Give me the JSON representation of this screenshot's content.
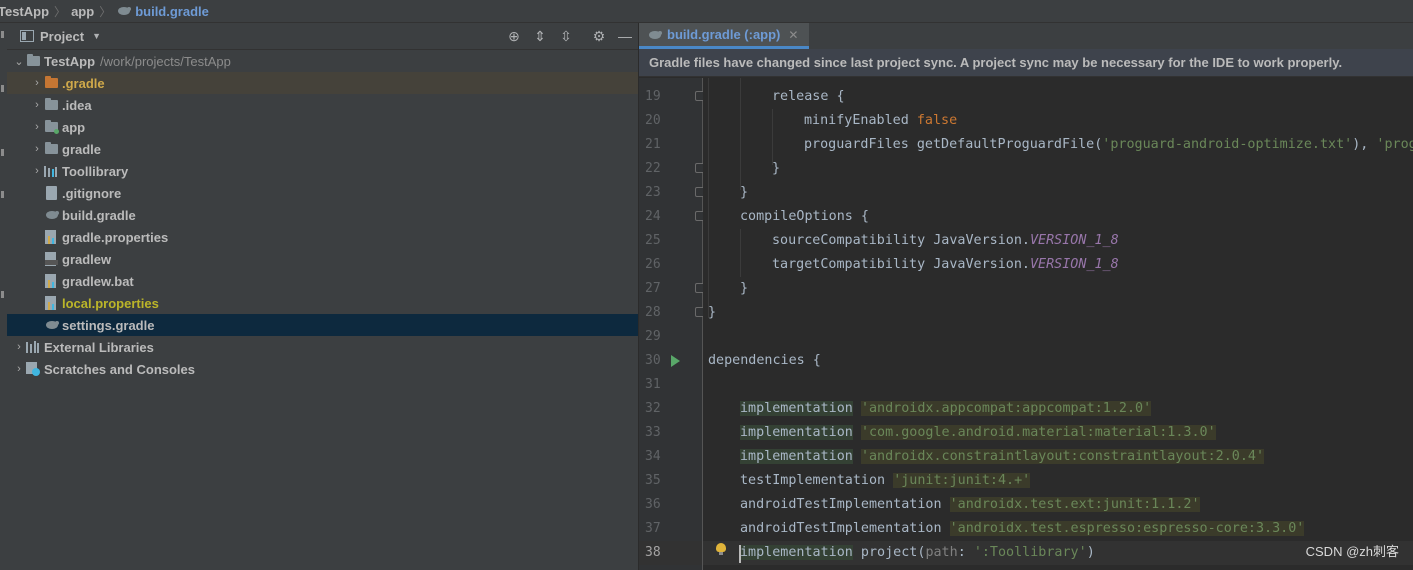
{
  "breadcrumb": [
    "TestApp",
    "app",
    "build.gradle"
  ],
  "project_panel": {
    "title": "Project",
    "root": {
      "label": "TestApp",
      "path": "/work/projects/TestApp"
    },
    "items": [
      {
        "label": ".gradle",
        "kind": "folder-orange",
        "expandable": true
      },
      {
        "label": ".idea",
        "kind": "folder",
        "expandable": true
      },
      {
        "label": "app",
        "kind": "module",
        "expandable": true
      },
      {
        "label": "gradle",
        "kind": "folder",
        "expandable": true
      },
      {
        "label": "Toollibrary",
        "kind": "library-module",
        "expandable": true
      },
      {
        "label": ".gitignore",
        "kind": "file"
      },
      {
        "label": "build.gradle",
        "kind": "gradle-file"
      },
      {
        "label": "gradle.properties",
        "kind": "properties-file"
      },
      {
        "label": "gradlew",
        "kind": "shell-file"
      },
      {
        "label": "gradlew.bat",
        "kind": "bat-file"
      },
      {
        "label": "local.properties",
        "kind": "properties-file"
      },
      {
        "label": "settings.gradle",
        "kind": "gradle-file",
        "selected": true
      }
    ],
    "external_libraries": "External Libraries",
    "scratches": "Scratches and Consoles"
  },
  "editor": {
    "tab_label": "build.gradle (:app)",
    "banner": "Gradle files have changed since last project sync. A project sync may be necessary for the IDE to work properly.",
    "line_numbers": [
      "19",
      "20",
      "21",
      "22",
      "23",
      "24",
      "25",
      "26",
      "27",
      "28",
      "29",
      "30",
      "31",
      "32",
      "33",
      "34",
      "35",
      "36",
      "37",
      "38"
    ]
  },
  "code": {
    "l19": "release {",
    "l20_a": "minifyEnabled ",
    "l20_b": "false",
    "l21_a": "proguardFiles getDefaultProguardFile(",
    "l21_b": "'proguard-android-optimize.txt'",
    "l21_c": "), ",
    "l21_d": "'prog",
    "l22": "}",
    "l23": "}",
    "l24": "compileOptions {",
    "l25_a": "sourceCompatibility JavaVersion.",
    "l25_b": "VERSION_1_8",
    "l26_a": "targetCompatibility JavaVersion.",
    "l26_b": "VERSION_1_8",
    "l27": "}",
    "l28": "}",
    "l30": "dependencies {",
    "l32_a": "implementation",
    "l32_b": "'androidx.appcompat:appcompat:1.2.0'",
    "l33_a": "implementation",
    "l33_b": "'com.google.android.material:material:1.3.0'",
    "l34_a": "implementation",
    "l34_b": "'androidx.constraintlayout:constraintlayout:2.0.4'",
    "l35_a": "testImplementation",
    "l35_b": "'junit:junit:4.+'",
    "l36_a": "androidTestImplementation",
    "l36_b": "'androidx.test.ext:junit:1.1.2'",
    "l37_a": "androidTestImplementation",
    "l37_b": "'androidx.test.espresso:espresso-core:3.3.0'",
    "l38_a": "implementation",
    "l38_b": " project(",
    "l38_c": "path",
    "l38_d": ": ",
    "l38_e": "':Toollibrary'",
    "l38_f": ")"
  },
  "watermark": "CSDN @zh刺客",
  "colors": {
    "keyword": "#cc7832",
    "string": "#6a8759",
    "constant": "#9876aa",
    "accent": "#4a88c7"
  }
}
